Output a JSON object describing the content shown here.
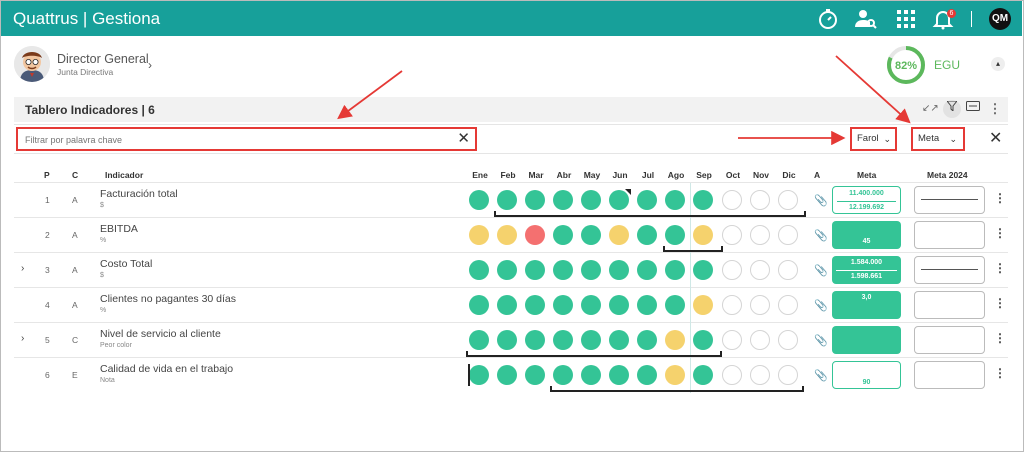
{
  "app": {
    "brand": "Quattrus",
    "product": "Gestiona",
    "notifications": "6",
    "user_initials": "QM"
  },
  "user": {
    "role": "Director General",
    "department": "Junta Directiva"
  },
  "score": {
    "value": "82%",
    "label": "EGU",
    "level": 0.82
  },
  "panel": {
    "title": "Tablero Indicadores | 6"
  },
  "filter": {
    "placeholder": "Filtrar por palavra chave",
    "farol": "Farol",
    "meta": "Meta"
  },
  "table": {
    "headers": {
      "p": "P",
      "c": "C",
      "indicador": "Indicador",
      "a": "A",
      "meta": "Meta",
      "meta2024": "Meta 2024"
    },
    "months": [
      "Ene",
      "Feb",
      "Mar",
      "Abr",
      "May",
      "Jun",
      "Jul",
      "Ago",
      "Sep",
      "Oct",
      "Nov",
      "Dic"
    ],
    "rows": [
      {
        "p": "1",
        "c": "A",
        "name": "Facturación total",
        "unit": "$",
        "expand": false,
        "status": [
          "g",
          "g",
          "g",
          "g",
          "g",
          "g",
          "g",
          "g",
          "g",
          "e",
          "e",
          "e"
        ],
        "meta_a": "11.400.000",
        "meta_b": "12.199.692",
        "meta_style": "out"
      },
      {
        "p": "2",
        "c": "A",
        "name": "EBITDA",
        "unit": "%",
        "expand": false,
        "status": [
          "y",
          "y",
          "r",
          "g",
          "g",
          "y",
          "g",
          "g",
          "y",
          "e",
          "e",
          "e"
        ],
        "meta_a": "",
        "meta_b": "45",
        "meta_style": "fill"
      },
      {
        "p": "3",
        "c": "A",
        "name": "Costo Total",
        "unit": "$",
        "expand": true,
        "status": [
          "g",
          "g",
          "g",
          "g",
          "g",
          "g",
          "g",
          "g",
          "g",
          "e",
          "e",
          "e"
        ],
        "meta_a": "1.584.000",
        "meta_b": "1.598.661",
        "meta_style": "fill"
      },
      {
        "p": "4",
        "c": "A",
        "name": "Clientes no pagantes 30 días",
        "unit": "%",
        "expand": false,
        "status": [
          "g",
          "g",
          "g",
          "g",
          "g",
          "g",
          "g",
          "g",
          "y",
          "e",
          "e",
          "e"
        ],
        "meta_a": "3,0",
        "meta_b": "",
        "meta_style": "fill"
      },
      {
        "p": "5",
        "c": "C",
        "name": "Nivel de servicio al cliente",
        "unit": "Peor color",
        "expand": true,
        "status": [
          "g",
          "g",
          "g",
          "g",
          "g",
          "g",
          "g",
          "y",
          "g",
          "e",
          "e",
          "e"
        ],
        "meta_a": "",
        "meta_b": "",
        "meta_style": "fill"
      },
      {
        "p": "6",
        "c": "E",
        "name": "Calidad de vida en el trabajo",
        "unit": "Nota",
        "expand": false,
        "status": [
          "g",
          "g",
          "g",
          "g",
          "g",
          "g",
          "g",
          "y",
          "g",
          "e",
          "e",
          "e"
        ],
        "meta_a": "",
        "meta_b": "90",
        "meta_style": "out"
      }
    ]
  },
  "colors": {
    "topbar": "#17a09a",
    "green": "#34c496",
    "yellow": "#f5d26d",
    "red": "#f47070",
    "highlight": "#e53935"
  }
}
